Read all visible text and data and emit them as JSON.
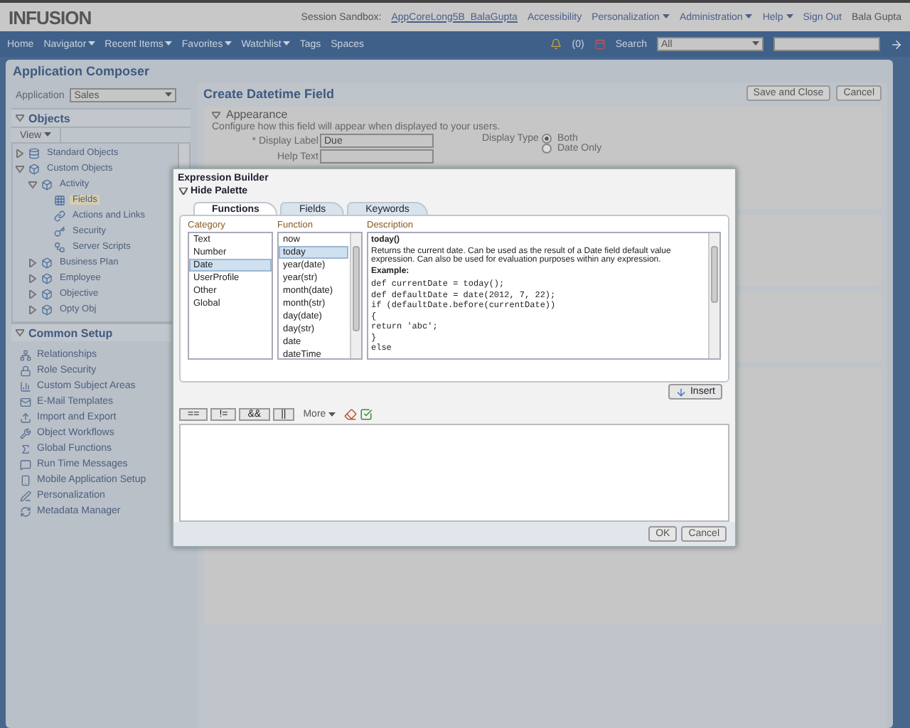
{
  "header": {
    "logo": "INFUSION",
    "session_label": "Session Sandbox:",
    "session_link": "AppCoreLong5B_BalaGupta",
    "links": [
      {
        "label": "Accessibility",
        "has_menu": false
      },
      {
        "label": "Personalization",
        "has_menu": true
      },
      {
        "label": "Administration",
        "has_menu": true
      },
      {
        "label": "Help",
        "has_menu": true
      },
      {
        "label": "Sign Out",
        "has_menu": false
      }
    ],
    "user": "Bala Gupta"
  },
  "navbar": {
    "items": [
      {
        "label": "Home",
        "has_menu": false
      },
      {
        "label": "Navigator",
        "has_menu": true
      },
      {
        "label": "Recent Items",
        "has_menu": true
      },
      {
        "label": "Favorites",
        "has_menu": true
      },
      {
        "label": "Watchlist",
        "has_menu": true
      },
      {
        "label": "Tags",
        "has_menu": false
      },
      {
        "label": "Spaces",
        "has_menu": false
      }
    ],
    "notifications": "(0)",
    "search_label": "Search",
    "search_scope": "All"
  },
  "panel_title": "Application Composer",
  "sidebar": {
    "application_label": "Application",
    "application_value": "Sales",
    "objects_title": "Objects",
    "view_menu": "View",
    "tree": [
      {
        "label": "Standard Objects",
        "expanded": false,
        "selected": false
      },
      {
        "label": "Custom Objects",
        "expanded": true,
        "selected": false,
        "children": [
          {
            "label": "Activity",
            "expanded": true,
            "selected": false,
            "children": [
              {
                "label": "Fields",
                "selected": true
              },
              {
                "label": "Actions and Links",
                "selected": false
              },
              {
                "label": "Security",
                "selected": false
              },
              {
                "label": "Server Scripts",
                "selected": false
              }
            ]
          },
          {
            "label": "Business Plan",
            "expanded": false,
            "selected": false
          },
          {
            "label": "Employee",
            "expanded": false,
            "selected": false
          },
          {
            "label": "Objective",
            "expanded": false,
            "selected": false
          },
          {
            "label": "Opty Obj",
            "expanded": false,
            "selected": false
          }
        ]
      }
    ],
    "common_setup_title": "Common Setup",
    "common_setup": [
      "Relationships",
      "Role Security",
      "Custom Subject Areas",
      "E-Mail Templates",
      "Import and Export",
      "Object Workflows",
      "Global Functions",
      "Run Time Messages",
      "Mobile Application Setup",
      "Personalization",
      "Metadata Manager"
    ]
  },
  "main": {
    "title": "Create Datetime Field",
    "buttons": [
      "Save and Close",
      "Cancel"
    ],
    "section_title": "Appearance",
    "section_hint": "Configure how this field will appear when displayed to your users.",
    "display_label_label": "* Display Label",
    "display_label_value": "Due",
    "help_text_label": "Help Text",
    "display_type_label": "Display Type",
    "display_types": [
      {
        "label": "Both",
        "selected": true
      },
      {
        "label": "Date Only",
        "selected": false
      }
    ]
  },
  "dialog": {
    "title": "Expression Builder",
    "palette_toggle": "Hide Palette",
    "tabs": [
      {
        "label": "Functions",
        "selected": true
      },
      {
        "label": "Fields",
        "selected": false
      },
      {
        "label": "Keywords",
        "selected": false
      }
    ],
    "category_header": "Category",
    "categories": [
      {
        "label": "Text",
        "selected": false
      },
      {
        "label": "Number",
        "selected": false
      },
      {
        "label": "Date",
        "selected": true
      },
      {
        "label": "UserProfile",
        "selected": false
      },
      {
        "label": "Other",
        "selected": false
      },
      {
        "label": "Global",
        "selected": false
      }
    ],
    "function_header": "Function",
    "functions": [
      {
        "label": "now",
        "selected": false
      },
      {
        "label": "today",
        "selected": true
      },
      {
        "label": "year(date)",
        "selected": false
      },
      {
        "label": "year(str)",
        "selected": false
      },
      {
        "label": "month(date)",
        "selected": false
      },
      {
        "label": "month(str)",
        "selected": false
      },
      {
        "label": "day(date)",
        "selected": false
      },
      {
        "label": "day(str)",
        "selected": false
      },
      {
        "label": "date",
        "selected": false
      },
      {
        "label": "dateTime",
        "selected": false
      }
    ],
    "description_header": "Description",
    "description_title": "today()",
    "description_text": "Returns the current date. Can be used as the result of a Date field default value expression. Can also be used for evaluation purposes within any expression.",
    "example_label": "Example:",
    "code": [
      "def currentDate = today();",
      "def defaultDate = date(2012, 7, 22);",
      "if (defaultDate.before(currentDate))",
      "{",
      "return 'abc';",
      "}",
      "else"
    ],
    "insert_button": "Insert",
    "operators": [
      "==",
      "!=",
      "&&",
      "||"
    ],
    "more_menu": "More",
    "ok_button": "OK",
    "cancel_button": "Cancel"
  }
}
